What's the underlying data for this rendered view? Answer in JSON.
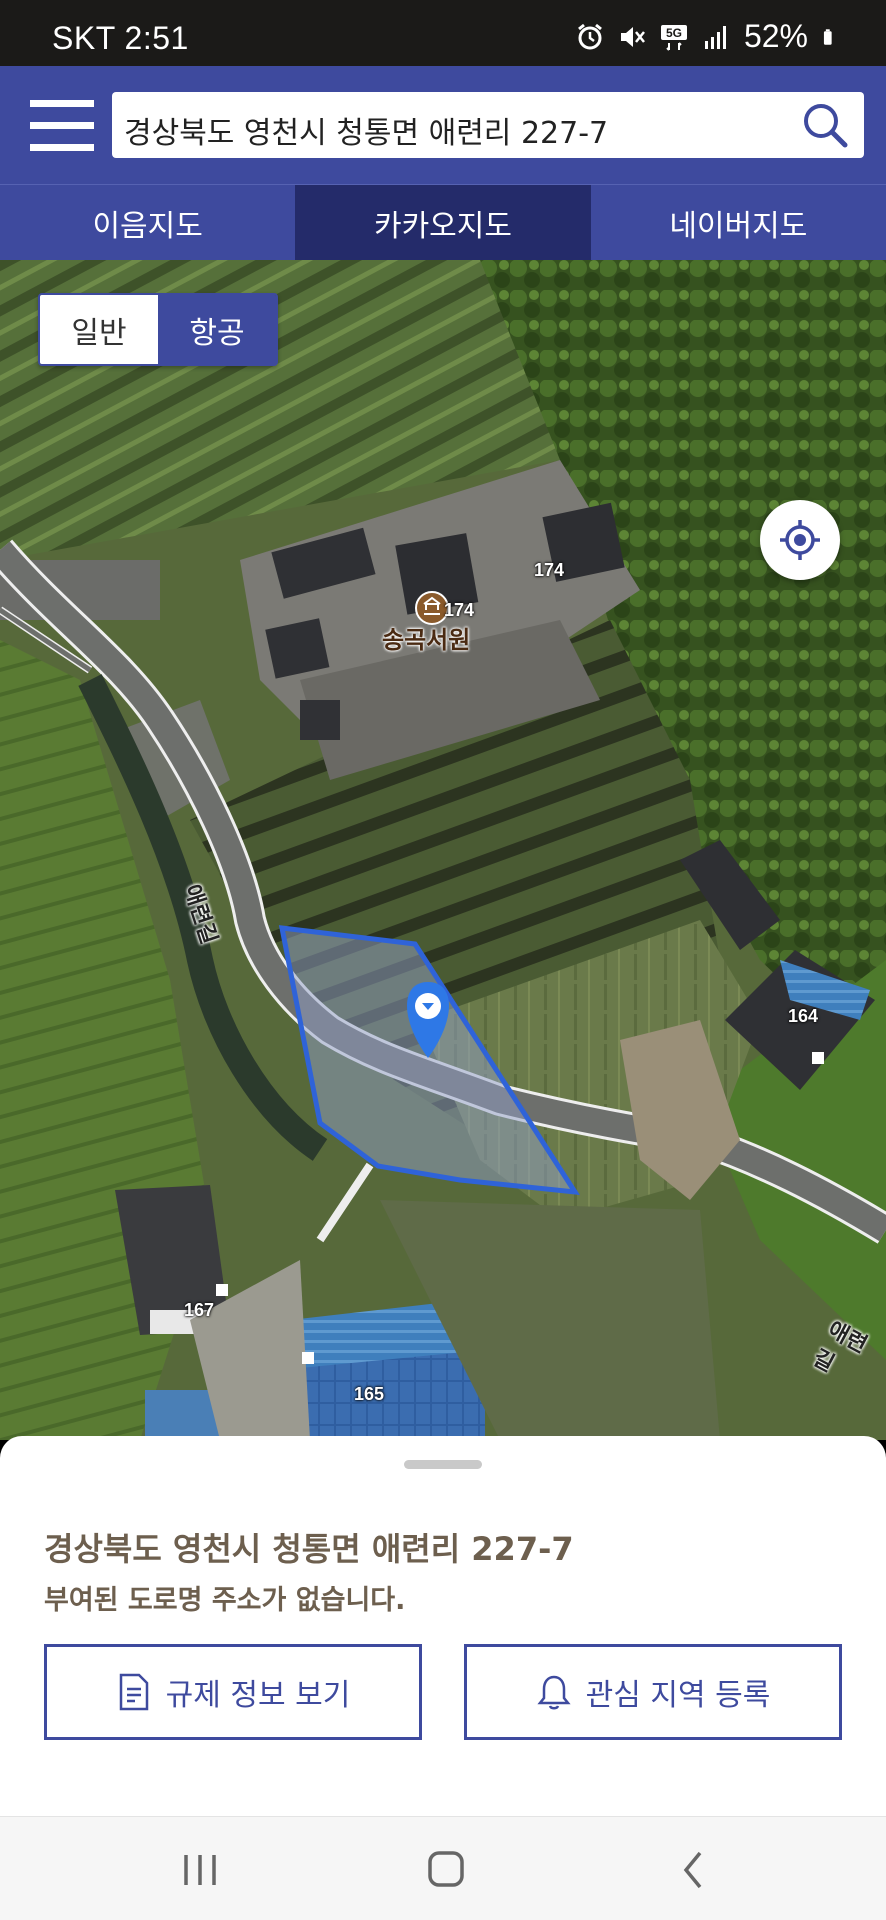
{
  "status_bar": {
    "carrier_time": "SKT 2:51",
    "network": "5G",
    "battery": "52%",
    "icons": [
      "alarm-icon",
      "mute-icon",
      "5g-icon",
      "signal-icon",
      "battery-icon"
    ]
  },
  "header": {
    "search_value": "경상북도 영천시 청통면 애련리 227-7",
    "icons": [
      "menu-icon",
      "search-icon"
    ]
  },
  "tabs": [
    {
      "label": "이음지도",
      "active": false
    },
    {
      "label": "카카오지도",
      "active": true
    },
    {
      "label": "네이버지도",
      "active": false
    }
  ],
  "map": {
    "type_options": [
      {
        "label": "일반",
        "selected": false
      },
      {
        "label": "항공",
        "selected": true
      }
    ],
    "labels": {
      "bldg_174a": "174",
      "bldg_174b": "174",
      "poi": "송곡서원",
      "road_1": "애련길",
      "road_2": "애련길",
      "bldg_164": "164",
      "bldg_167": "167",
      "bldg_165": "165"
    },
    "colors": {
      "parcel_outline": "#2f63d8",
      "marker": "#2e78e6"
    }
  },
  "sheet": {
    "address": "경상북도 영천시 청통면 애련리 227-7",
    "road_address_note": "부여된 도로명 주소가 없습니다.",
    "btn_regulation": "규제 정보 보기",
    "btn_interest": "관심 지역 등록"
  },
  "nav": {
    "icons": [
      "recent-apps-icon",
      "home-icon",
      "back-icon"
    ]
  },
  "theme": {
    "primary": "#3e4a9e",
    "primary_dark": "#242b6a",
    "address_text": "#6d5f4e"
  }
}
